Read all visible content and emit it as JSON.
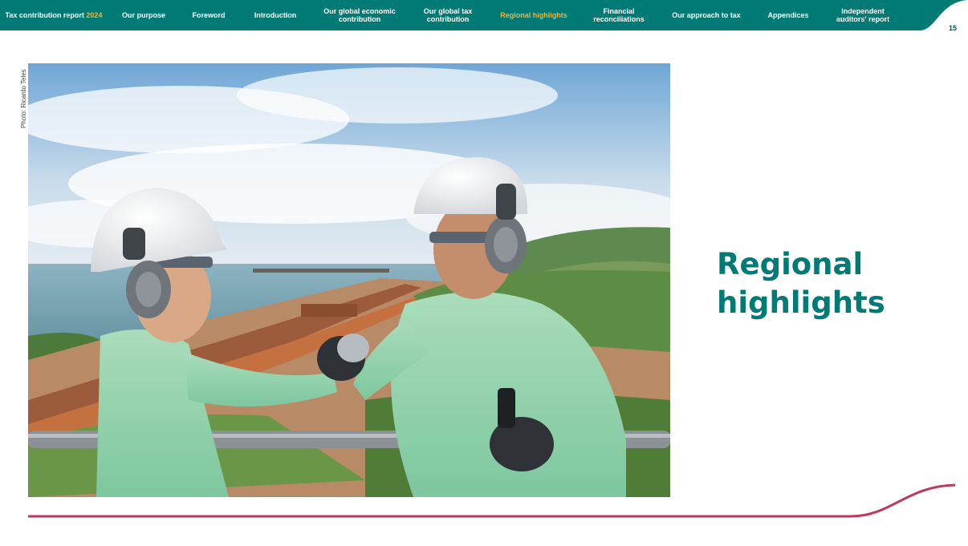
{
  "nav": {
    "brand": "Tax contribution report",
    "brand_year": "2024",
    "items": [
      {
        "line1": "Our purpose",
        "line2": ""
      },
      {
        "line1": "Foreword",
        "line2": ""
      },
      {
        "line1": "Introduction",
        "line2": ""
      },
      {
        "line1": "Our global economic",
        "line2": "contribution"
      },
      {
        "line1": "Our global tax",
        "line2": "contribution"
      },
      {
        "line1": "Regional highlights",
        "line2": ""
      },
      {
        "line1": "Financial",
        "line2": "reconciliations"
      },
      {
        "line1": "Our approach to tax",
        "line2": ""
      },
      {
        "line1": "Appendices",
        "line2": ""
      },
      {
        "line1": "Independent",
        "line2": "auditors' report"
      }
    ],
    "page_number": "15"
  },
  "photo": {
    "credit": "Photo: Ricardo Teles"
  },
  "section": {
    "title_line1": "Regional",
    "title_line2": "highlights"
  },
  "colors": {
    "brand_teal": "#007a74",
    "active_nav": "#f5b335",
    "accent_line": "#c0365f"
  }
}
